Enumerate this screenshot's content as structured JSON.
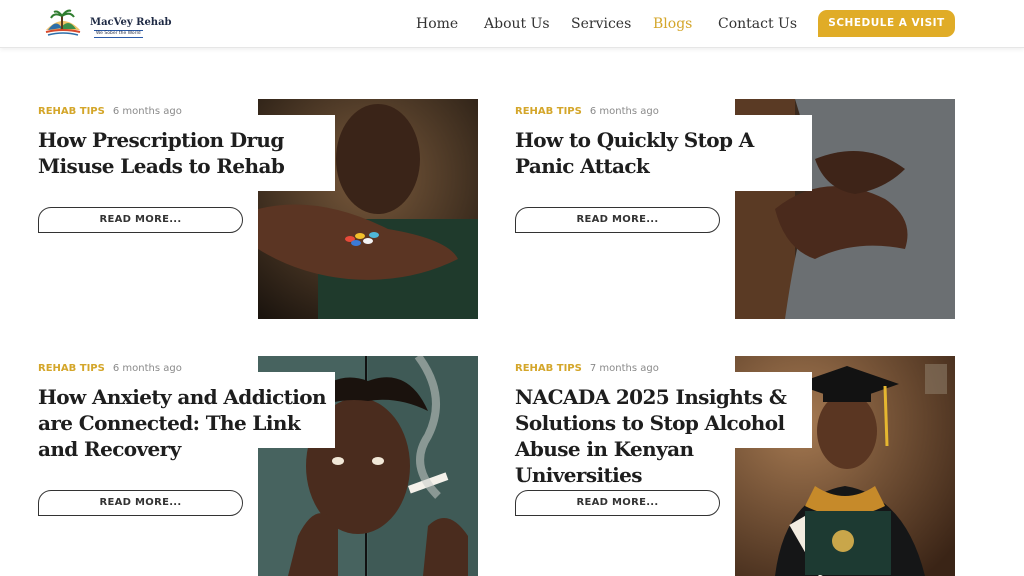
{
  "brand": {
    "name": "MacVey Rehab",
    "tagline": "We Sober the World"
  },
  "nav": {
    "items": [
      {
        "label": "Home"
      },
      {
        "label": "About Us"
      },
      {
        "label": "Services"
      },
      {
        "label": "Blogs"
      },
      {
        "label": "Contact Us"
      }
    ],
    "active": "Blogs",
    "cta_label": "SCHEDULE A VISIT"
  },
  "posts": [
    {
      "category": "REHAB TIPS",
      "time": "6 months ago",
      "title": "How Prescription Drug Misuse Leads to Rehab",
      "read_more": "READ MORE..."
    },
    {
      "category": "REHAB TIPS",
      "time": "6 months ago",
      "title": "How to Quickly Stop A Panic Attack",
      "read_more": "READ MORE..."
    },
    {
      "category": "REHAB TIPS",
      "time": "6 months ago",
      "title": "How Anxiety and Addiction are Connected: The Link and Recovery",
      "read_more": "READ MORE..."
    },
    {
      "category": "REHAB TIPS",
      "time": "7 months ago",
      "title": "NACADA 2025 Insights & Solutions to Stop Alcohol Abuse in Kenyan Universities",
      "read_more": "READ MORE..."
    }
  ],
  "colors": {
    "accent": "#e0ac27",
    "category": "#d4a62a",
    "text": "#1e1e1e"
  }
}
